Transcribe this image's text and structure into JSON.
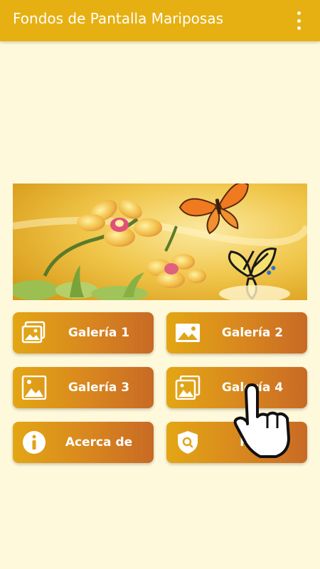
{
  "app_bar": {
    "title": "Fondos de Pantalla Mariposas",
    "menu_icon": "more-vert-icon"
  },
  "banner": {
    "description_icon": "butterfly-orchid-banner"
  },
  "buttons": [
    {
      "label": "Galería 1",
      "icon": "photo-stack-icon"
    },
    {
      "label": "Galería 2",
      "icon": "image-icon"
    },
    {
      "label": "Galería 3",
      "icon": "landscape-image-icon"
    },
    {
      "label": "Galería 4",
      "icon": "landscape-stack-icon"
    },
    {
      "label": "Acerca de",
      "icon": "info-icon"
    },
    {
      "label": "Poli",
      "icon": "shield-search-icon"
    }
  ],
  "colors": {
    "app_bar": "#e6b012",
    "background": "#fff9dc",
    "button_start": "#e3a614",
    "button_end": "#c86a25"
  }
}
